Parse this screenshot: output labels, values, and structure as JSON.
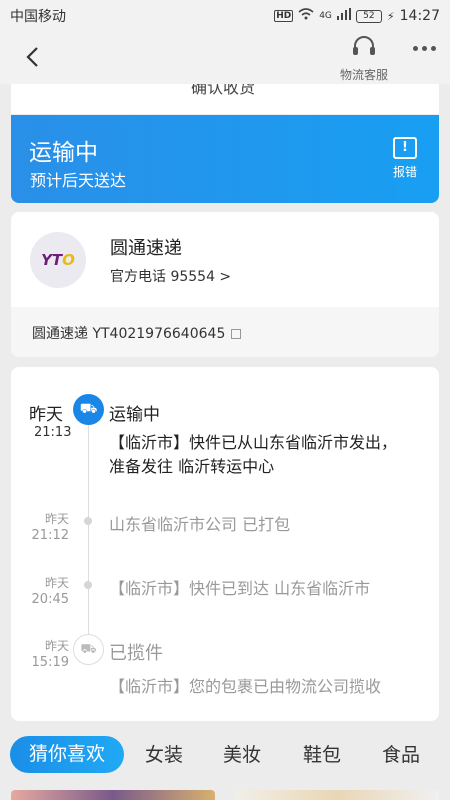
{
  "statusbar": {
    "carrier": "中国移动",
    "hd": "HD",
    "network": "4G",
    "battery": "52",
    "time": "14:27"
  },
  "nav": {
    "service_label": "物流客服"
  },
  "clipped_text": "确认收货",
  "banner": {
    "status": "运输中",
    "eta": "预计后天送达",
    "report_label": "报错",
    "report_icon": "!"
  },
  "courier": {
    "logo_text_a": "YT",
    "logo_text_b": "O",
    "name": "圆通速递",
    "phone": "官方电话 95554 >",
    "tracking": "圆通速递 YT4021976640645"
  },
  "timeline": [
    {
      "day": "昨天",
      "time": "21:13",
      "title": "运输中",
      "text": "【临沂市】快件已从山东省临沂市发出，准备发往 临沂转运中心"
    },
    {
      "day": "昨天",
      "time": "21:12",
      "text": "山东省临沂市公司 已打包"
    },
    {
      "day": "昨天",
      "time": "20:45",
      "text": "【临沂市】快件已到达 山东省临沂市"
    },
    {
      "day": "昨天",
      "time": "15:19",
      "title": "已揽件",
      "text": "【临沂市】您的包裹已由物流公司揽收"
    }
  ],
  "tabs": [
    "猜你喜欢",
    "女装",
    "美妆",
    "鞋包",
    "食品"
  ],
  "colors": {
    "accent": "#1a86e5",
    "background": "#ececec"
  }
}
